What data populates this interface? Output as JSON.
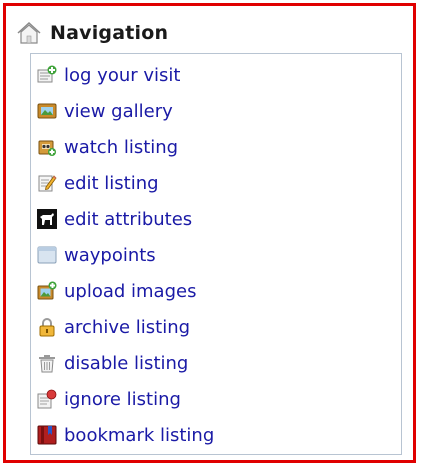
{
  "header": {
    "title": "Navigation",
    "icon": "house-icon"
  },
  "colors": {
    "frame_border": "#e00000",
    "panel_border": "#b8c4d2",
    "link": "#1a1aa6"
  },
  "nav": {
    "items": [
      {
        "label": "log your visit",
        "icon": "log-visit-icon"
      },
      {
        "label": "view gallery",
        "icon": "gallery-icon"
      },
      {
        "label": "watch listing",
        "icon": "watch-icon"
      },
      {
        "label": "edit listing",
        "icon": "edit-icon"
      },
      {
        "label": "edit attributes",
        "icon": "attributes-icon"
      },
      {
        "label": "waypoints",
        "icon": "waypoints-icon"
      },
      {
        "label": "upload images",
        "icon": "upload-images-icon"
      },
      {
        "label": "archive listing",
        "icon": "lock-icon"
      },
      {
        "label": "disable listing",
        "icon": "trash-icon"
      },
      {
        "label": "ignore listing",
        "icon": "ignore-icon"
      },
      {
        "label": "bookmark listing",
        "icon": "bookmark-icon"
      }
    ]
  }
}
